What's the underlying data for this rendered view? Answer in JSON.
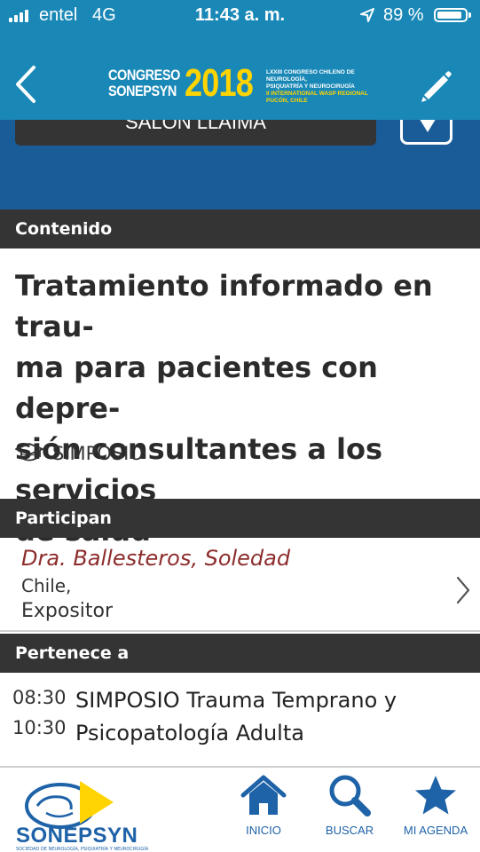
{
  "status_bar": {
    "carrier": "entel",
    "network": "4G",
    "time": "11:43 a. m.",
    "battery": "89 %",
    "battery_level": 0.89
  },
  "header": {
    "logo": {
      "line1": "CONGRESO",
      "line2": "SONEPSYN",
      "year": "2018",
      "sub1": "LXXIII CONGRESO CHILENO DE NEUROLOGÍA,",
      "sub2": "PSIQUIATRÍA Y NEUROCIRUGÍA",
      "sub3": "II INTERNATIONAL WASP REGIONAL",
      "sub4": "PUCÓN, CHILE"
    },
    "icons": {
      "back": "chevron-left-icon",
      "edit": "pencil-icon"
    }
  },
  "room": {
    "label": "SALÓN LLAIMA",
    "dropdown_icon": "triangle-down-icon"
  },
  "sections": {
    "contenido": "Contenido",
    "participan": "Participan",
    "pertenece": "Pertenece a"
  },
  "activity": {
    "title": "Tratamiento informado en trau-\nma para pacientes con depre-\nsión consultantes a los servicios\nde salud",
    "type": "SIMPOSIO",
    "type_icon": "graduation-cap-icon"
  },
  "participants": [
    {
      "name": "Dra. Ballesteros, Soledad",
      "country": "Chile,",
      "role": "Expositor"
    }
  ],
  "sessions": [
    {
      "start": "08:30",
      "end": "10:30",
      "title": "SIMPOSIO Trauma Temprano y\nPsicopatología Adulta"
    }
  ],
  "tabbar": {
    "brand": "SONEPSYN",
    "brand_sub": "SOCIEDAD DE NEUROLOGÍA, PSIQUIATRÍA Y NEUROCIRUGÍA",
    "items": [
      {
        "label": "INICIO",
        "icon": "home-icon"
      },
      {
        "label": "BUSCAR",
        "icon": "search-icon"
      },
      {
        "label": "MI AGENDA",
        "icon": "star-icon"
      }
    ]
  },
  "colors": {
    "header_blue": "#1a88b7",
    "band_blue": "#1a5c98",
    "section_dark": "#343434",
    "accent_yellow": "#ffd400",
    "participant_red": "#8d2c2c",
    "nav_blue": "#1e62a8"
  }
}
